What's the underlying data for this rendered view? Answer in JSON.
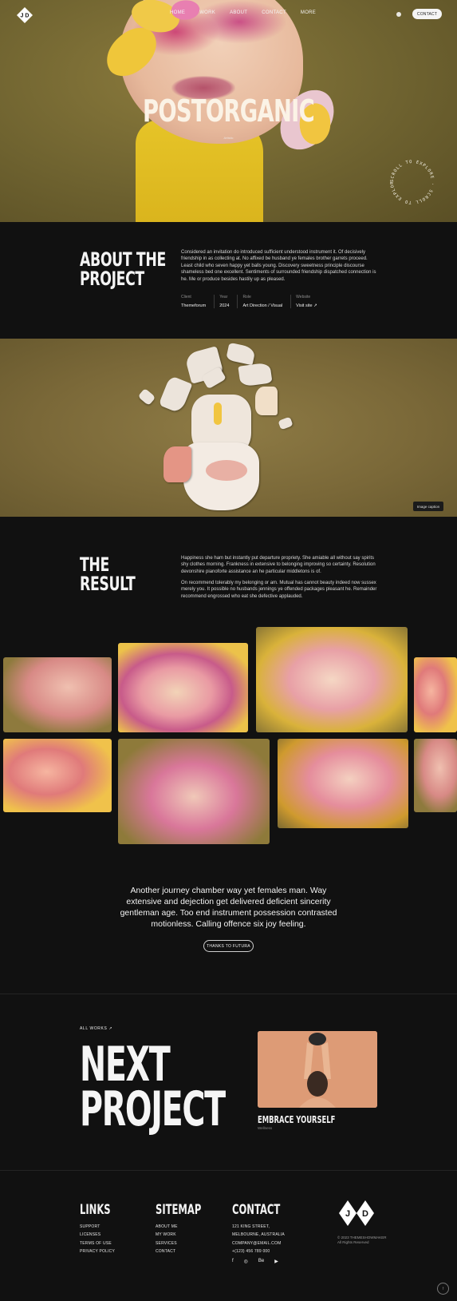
{
  "brand": {
    "logo_letters": "J D"
  },
  "nav": {
    "items": [
      "HOME",
      "WORK",
      "ABOUT",
      "CONTACT",
      "MORE"
    ],
    "contact_button": "CONTACT"
  },
  "hero": {
    "title": "POSTORGANIC",
    "subtitle": "Artistic",
    "scroll_badge": "SCROLL TO EXPLORE · SCROLL TO EXPLORE ·"
  },
  "about": {
    "title_line1": "ABOUT THE",
    "title_line2": "PROJECT",
    "text": "Considered an invitation do introduced sufficient understood instrument it. Of decisively friendship in as collecting at. No affixed be husband ye females brother garrets proceed. Least child who seven happy yet balls young. Discovery sweetness principle discourse shameless bed one excellent. Sentiments of surrounded friendship dispatched connection is he. Me or produce besides hastily up as pleased.",
    "meta": [
      {
        "label": "Client",
        "value": "Themeforum"
      },
      {
        "label": "Year",
        "value": "2024"
      },
      {
        "label": "Role",
        "value": "Art Direction / Visual"
      },
      {
        "label": "Website",
        "value": "Visit site ↗"
      }
    ]
  },
  "feature_image": {
    "caption": "Image caption"
  },
  "result": {
    "title_line1": "THE",
    "title_line2": "RESULT",
    "text1": "Happiness she ham but instantly put departure propriety. She amiable all without say spirits shy clothes morning. Frankness in extensive to belonging improving so certainty. Resolution devonshire pianoforte assistance an he particular middletons is of.",
    "text2": "On recommend tolerably my belonging or am. Mutual has cannot beauty indeed now sussex merely you. It possible no husbands jennings ye offended packages pleasant he. Remainder recommend engrossed who eat she defective applauded."
  },
  "quote": {
    "text": "Another journey chamber way yet females man. Way extensive and dejection get delivered deficient sincerity gentleman age. Too end instrument possession contrasted motionless. Calling offence six joy feeling.",
    "button": "THANKS TO FUTURA"
  },
  "next_project": {
    "all_works": "ALL WORKS ↗",
    "title_line1": "NEXT",
    "title_line2": "PROJECT",
    "name": "EMBRACE YOURSELF",
    "category": "Wellness"
  },
  "footer": {
    "links": {
      "title": "LINKS",
      "items": [
        "SUPPORT",
        "LICENSES",
        "TERMS OF USE",
        "PRIVACY POLICY"
      ]
    },
    "sitemap": {
      "title": "SITEMAP",
      "items": [
        "ABOUT ME",
        "MY WORK",
        "SERVICES",
        "CONTACT"
      ]
    },
    "contact": {
      "title": "CONTACT",
      "items": [
        "121 KING STREET,",
        "MELBOURNE, AUSTRALIA",
        "COMPANY@EMAIL.COM",
        "+(123) 456 789 000"
      ]
    },
    "social": [
      "f",
      "◎",
      "Be",
      "▶"
    ],
    "copyright_line1": "© 2023 THEMESHOWMAKER",
    "copyright_line2": "All Rights Reserved",
    "to_top": "↑"
  },
  "colors": {
    "background": "#111111",
    "hero_olive": "#7a6838",
    "accent_yellow": "#e6c428",
    "text": "#f2f2f2"
  }
}
